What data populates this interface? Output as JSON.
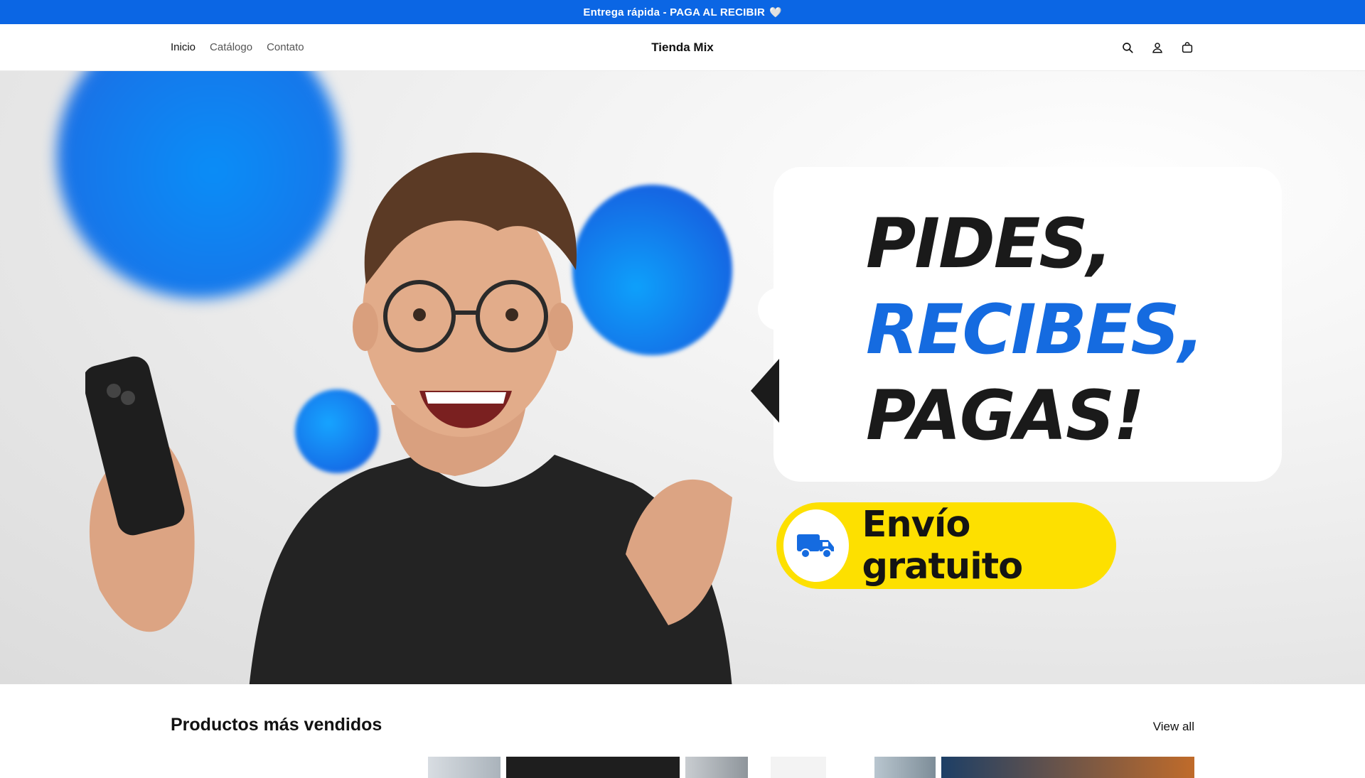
{
  "announcement": {
    "text": "Entrega rápida - PAGA AL RECIBIR",
    "heart": "🤍"
  },
  "header": {
    "nav": [
      {
        "label": "Inicio",
        "active": true
      },
      {
        "label": "Catálogo",
        "active": false
      },
      {
        "label": "Contato",
        "active": false
      }
    ],
    "brand": "Tienda Mix",
    "icons": [
      "search-icon",
      "account-icon",
      "cart-icon"
    ]
  },
  "hero": {
    "headline_1": "PIDES,",
    "headline_2": "RECIBES,",
    "headline_3": "PAGAS!",
    "badge": "Envío gratuito"
  },
  "products": {
    "title": "Productos más vendidos",
    "view_all": "View all"
  },
  "colors": {
    "accent": "#0b66e4",
    "badge": "#fde000"
  }
}
